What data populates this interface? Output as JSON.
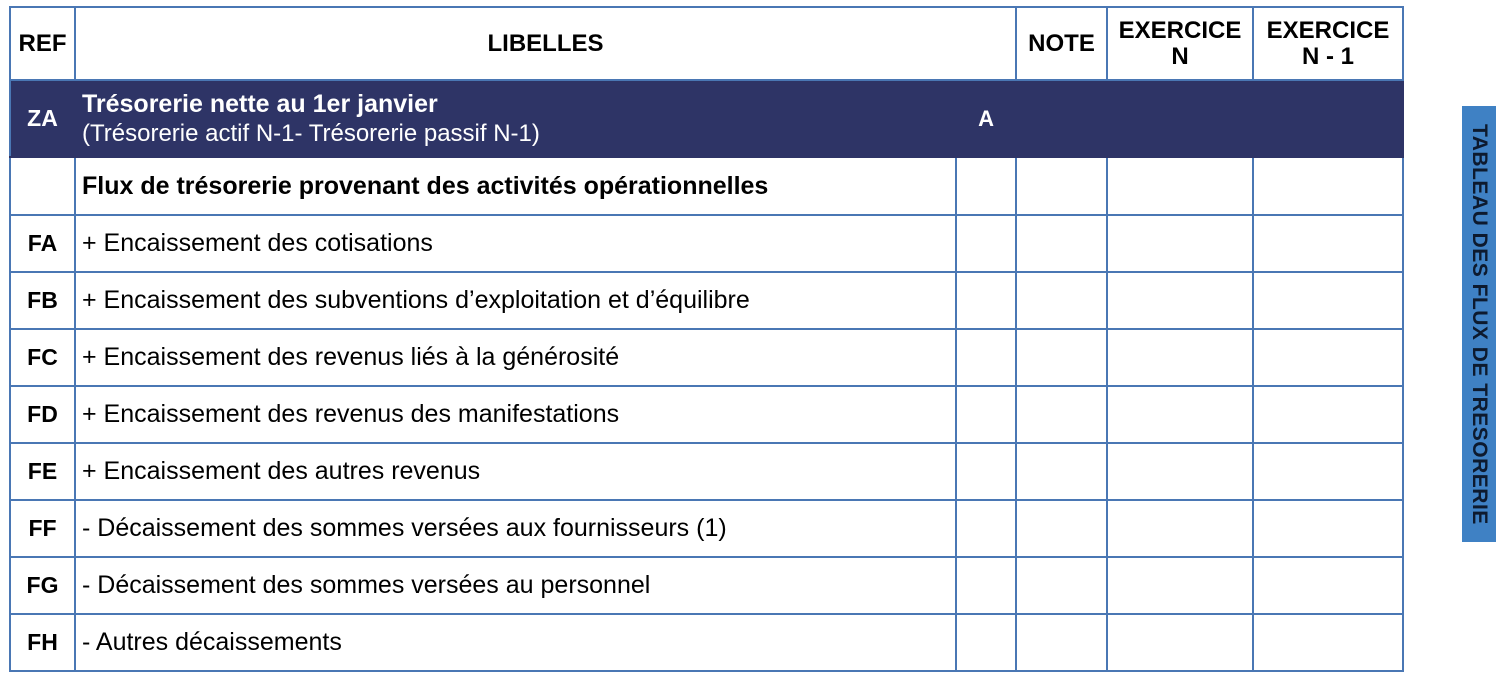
{
  "headers": {
    "ref": "REF",
    "libelles": "LIBELLES",
    "note": "NOTE",
    "exercice_n_l1": "EXERCICE",
    "exercice_n_l2": "N",
    "exercice_n1_l1": "EXERCICE",
    "exercice_n1_l2": "N - 1"
  },
  "rows": [
    {
      "ref": "ZA",
      "line1": "Trésorerie nette au 1er janvier",
      "line2": "(Trésorerie actif N-1- Trésorerie passif N-1)",
      "code": "A"
    },
    {
      "ref": "",
      "label": "Flux de trésorerie provenant des activités opérationnelles"
    },
    {
      "ref": "FA",
      "label": "+ Encaissement des cotisations"
    },
    {
      "ref": "FB",
      "label": "+ Encaissement des subventions d’exploitation et d’équilibre"
    },
    {
      "ref": "FC",
      "label": "+ Encaissement des revenus liés à la générosité"
    },
    {
      "ref": "FD",
      "label": "+ Encaissement des revenus des manifestations"
    },
    {
      "ref": "FE",
      "label": "+ Encaissement des autres revenus"
    },
    {
      "ref": "FF",
      "label": "- Décaissement des sommes versées aux fournisseurs (1)"
    },
    {
      "ref": "FG",
      "label": "- Décaissement des sommes versées au personnel"
    },
    {
      "ref": "FH",
      "label": "- Autres décaissements"
    }
  ],
  "sidebar": {
    "title": "TABLEAU DES FLUX DE TRESORERIE"
  },
  "colors": {
    "border": "#4a77b4",
    "band": "#2e3466",
    "sidebar": "#3f81c4"
  }
}
